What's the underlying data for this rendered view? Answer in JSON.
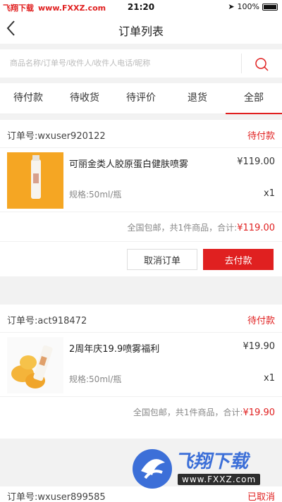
{
  "status_bar": {
    "site_name": "飞翔下载",
    "site_url": "www.FXXZ.com",
    "time": "21:20",
    "battery": "100%"
  },
  "nav": {
    "back_icon": "chevron-left-icon",
    "title": "订单列表"
  },
  "search": {
    "placeholder": "商品名称/订单号/收件人/收件人电话/昵称",
    "icon": "search-icon"
  },
  "tabs": [
    {
      "label": "待付款"
    },
    {
      "label": "待收货"
    },
    {
      "label": "待评价"
    },
    {
      "label": "退货"
    },
    {
      "label": "全部"
    }
  ],
  "active_tab": "全部",
  "orders": [
    {
      "order_no": "订单号:wxuser920122",
      "status": "待付款",
      "item": {
        "name": "可丽金类人胶原蛋白健肤喷雾",
        "price": "¥119.00",
        "spec": "规格:50ml/瓶",
        "qty": "x1"
      },
      "summary_prefix": "全国包邮，共1件商品，合计:",
      "summary_total": "¥119.00",
      "cancel_label": "取消订单",
      "pay_label": "去付款"
    },
    {
      "order_no": "订单号:act918472",
      "status": "待付款",
      "item": {
        "name": "2周年庆19.9喷雾福利",
        "price": "¥19.90",
        "spec": "规格:50ml/瓶",
        "qty": "x1"
      },
      "summary_prefix": "全国包邮，共1件商品，合计:",
      "summary_total": "¥19.90"
    },
    {
      "order_no": "订单号:wxuser899585",
      "status": "已取消"
    }
  ],
  "watermark": {
    "text": "飞翔下载",
    "url": "www.FXXZ.com"
  },
  "colors": {
    "accent": "#e02020",
    "background": "#f2f2f2"
  }
}
